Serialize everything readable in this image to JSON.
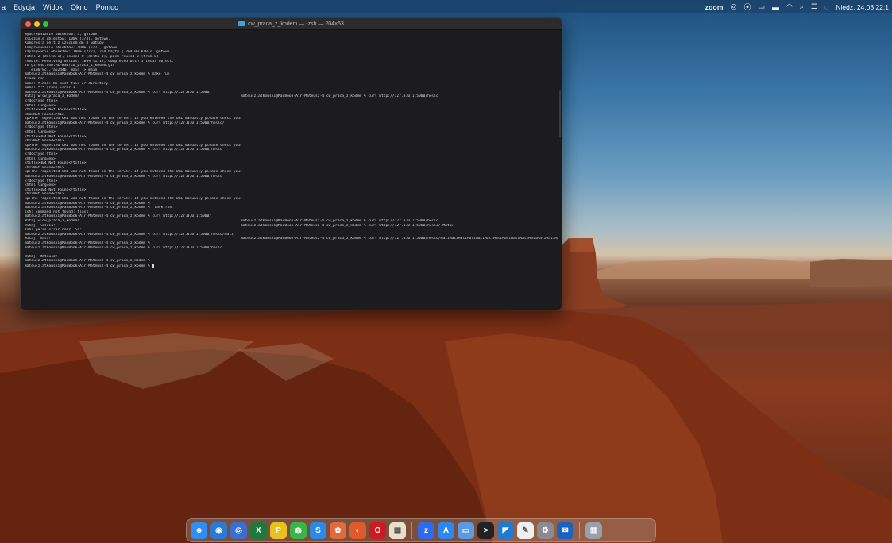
{
  "menubar": {
    "menus": [
      "a",
      "Edycja",
      "Widok",
      "Okno",
      "Pomoc"
    ],
    "status": {
      "zoom": "zoom",
      "datetime": "Niedz. 24.03 22:1"
    }
  },
  "terminal": {
    "title": "cw_praca_z_kodem — -zsh — 204×53",
    "lines": [
      [
        "Wyodrębnianie obiektów: 3, gotowe.",
        ""
      ],
      [
        "Zliczanie obiektów: 100% (3/3), gotowe.",
        ""
      ],
      [
        "Kompresja delt z użyciem do 8 wątków",
        ""
      ],
      [
        "Kompresowanie obiektów: 100% (2/2), gotowe.",
        ""
      ],
      [
        "Zapisywanie obiektów: 100% (2/2), 264 bajty | 264.00 KiB/s, gotowe.",
        ""
      ],
      [
        "Total 2 (delta 1), reused 0 (delta 0), pack-reused 0 (from 0)",
        ""
      ],
      [
        "remote: Resolving deltas: 100% (1/1), completed with 1 local object.",
        ""
      ],
      [
        "To github.com:ML-WSB/cw_praca_z_kodem.git",
        ""
      ],
      [
        "   e1d6f8c..fa62d4b  main -> main",
        ""
      ],
      [
        "mateuszlatkowski@MacBook-Air-Mateusz-4 cw_praca_z_kodem % make run",
        ""
      ],
      [
        "flask run",
        ""
      ],
      [
        "make: flask: No such file or directory",
        ""
      ],
      [
        "make: *** [run] Error 1",
        ""
      ],
      [
        "mateuszlatkowski@MacBook-Air-Mateusz-4 cw_praca_z_kodem % curl http://127.0.0.1:5000/",
        ""
      ],
      [
        "Witaj w cw_praca_z_kodem!",
        "mateuszlatkowski@MacBook-Air-Mateusz-4 cw_praca_z_kodem % curl http://127.0.0.1:5000/hello"
      ],
      [
        "<!doctype html>",
        ""
      ],
      [
        "<html lang=en>",
        ""
      ],
      [
        "<title>404 Not Found</title>",
        ""
      ],
      [
        "<h1>Not Found</h1>",
        ""
      ],
      [
        "<p>The requested URL was not found on the server. If you entered the URL manually please check your spelling and try again.</p>",
        ""
      ],
      [
        "mateuszlatkowski@MacBook-Air-Mateusz-4 cw_praca_z_kodem % curl http://127.0.0.1:5000/hello/",
        ""
      ],
      [
        "<!doctype html>",
        ""
      ],
      [
        "<html lang=en>",
        ""
      ],
      [
        "<title>404 Not Found</title>",
        ""
      ],
      [
        "<h1>Not Found</h1>",
        ""
      ],
      [
        "<p>The requested URL was not found on the server. If you entered the URL manually please check your spelling and try again.</p>",
        ""
      ],
      [
        "mateuszlatkowski@MacBook-Air-Mateusz-4 cw_praca_z_kodem % curl http://127.0.0.1:5000/hello",
        ""
      ],
      [
        "<!doctype html>",
        ""
      ],
      [
        "<html lang=en>",
        ""
      ],
      [
        "<title>404 Not Found</title>",
        ""
      ],
      [
        "<h1>Not Found</h1>",
        ""
      ],
      [
        "<p>The requested URL was not found on the server. If you entered the URL manually please check your spelling and try again.</p>",
        ""
      ],
      [
        "mateuszlatkowski@MacBook-Air-Mateusz-4 cw_praca_z_kodem % curl http://127.0.0.1:5000/hello",
        ""
      ],
      [
        "<!doctype html>",
        ""
      ],
      [
        "<html lang=en>",
        ""
      ],
      [
        "<title>404 Not Found</title>",
        ""
      ],
      [
        "<h1>Not Found</h1>",
        ""
      ],
      [
        "<p>The requested URL was not found on the server. If you entered the URL manually please check your spelling and try again.</p>",
        ""
      ],
      [
        "mateuszlatkowski@MacBook-Air-Mateusz-4 cw_praca_z_kodem %",
        ""
      ],
      [
        "mateuszlatkowski@MacBook-Air-Mateusz-4 cw_praca_z_kodem % flask run",
        ""
      ],
      [
        "zsh: command not found: flask",
        ""
      ],
      [
        "mateuszlatkowski@MacBook-Air-Mateusz-4 cw_praca_z_kodem % curl http://127.0.0.1:5000/",
        ""
      ],
      [
        "Witaj w cw_praca_z_kodem!",
        "mateuszlatkowski@MacBook-Air-Mateusz-4 cw_praca_z_kodem % curl http://127.0.0.1:5000/hello"
      ],
      [
        "Witaj, Gościu!",
        "mateuszlatkowski@MacBook-Air-Mateusz-4 cw_praca_z_kodem % curl http://127.0.0.1:5000/hello/<Mati>"
      ],
      [
        "zsh: parse error near `\\n'",
        ""
      ],
      [
        "mateuszlatkowski@MacBook-Air-Mateusz-4 cw_praca_z_kodem % curl http://127.0.0.1:5000/hello/Mati",
        ""
      ],
      [
        "Witaj, Mati!",
        "mateuszlatkowski@MacBook-Air-Mateusz-4 cw_praca_z_kodem % curl http://127.0.0.1:5000/hello/MatiMatiMatiMatiMatiMatiMatiMatiMatiMatiMatiMatiMatiMatiMatiMatiMatiMatiMatiMati"
      ],
      [
        "mateuszlatkowski@MacBook-Air-Mateusz-4 cw_praca_z_kodem %",
        ""
      ],
      [
        "mateuszlatkowski@MacBook-Air-Mateusz-4 cw_praca_z_kodem % curl http://127.0.0.1:5000/hello",
        ""
      ],
      [
        "",
        ""
      ],
      [
        "Witaj, Mateusz!",
        ""
      ],
      [
        "mateuszlatkowski@MacBook-Air-Mateusz-4 cw_praca_z_kodem %",
        ""
      ],
      [
        "mateuszlatkowski@MacBook-Air-Mateusz-4 cw_praca_z_kodem % ",
        ""
      ]
    ]
  },
  "dock": {
    "apps": [
      {
        "name": "finder-icon",
        "glyph": "☻",
        "color": "#2f8ff0"
      },
      {
        "name": "chrome-icon",
        "glyph": "◉",
        "color": "#2a7ad6"
      },
      {
        "name": "safari-icon",
        "glyph": "◎",
        "color": "#3a6fd0"
      },
      {
        "name": "excel-icon",
        "glyph": "X",
        "color": "#1e7a3c"
      },
      {
        "name": "pycharm-icon",
        "glyph": "P",
        "color": "#e8c020"
      },
      {
        "name": "messages-icon",
        "glyph": "◍",
        "color": "#39b54a"
      },
      {
        "name": "skype-icon",
        "glyph": "S",
        "color": "#2a8ae6"
      },
      {
        "name": "photos-icon",
        "glyph": "✿",
        "color": "#e06a3a"
      },
      {
        "name": "firefox-icon",
        "glyph": "◐",
        "color": "#e05a2a"
      },
      {
        "name": "opera-icon",
        "glyph": "O",
        "color": "#cc1a22"
      },
      {
        "name": "calendar-icon",
        "glyph": "▦",
        "color": "#e8e0c8"
      },
      {
        "name": "zoom-app-icon",
        "glyph": "z",
        "color": "#2d6cf0"
      },
      {
        "name": "app-store-icon",
        "glyph": "A",
        "color": "#2a88f0"
      },
      {
        "name": "finder-window-icon",
        "glyph": "▭",
        "color": "#5a9ae0"
      },
      {
        "name": "terminal-icon",
        "glyph": ">",
        "color": "#222224"
      },
      {
        "name": "vscode-icon",
        "glyph": "◤",
        "color": "#1f7ad0"
      },
      {
        "name": "notes-icon",
        "glyph": "✎",
        "color": "#f0f0f0"
      },
      {
        "name": "system-prefs-icon",
        "glyph": "⚙",
        "color": "#8a8a90"
      },
      {
        "name": "outlook-icon",
        "glyph": "✉",
        "color": "#1a62c0"
      },
      {
        "name": "trash-icon",
        "glyph": "▥",
        "color": "#9aa0a8"
      }
    ]
  }
}
